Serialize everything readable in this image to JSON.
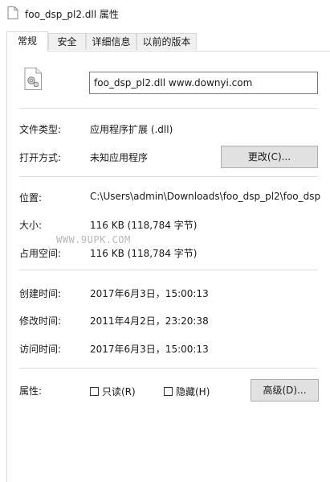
{
  "window": {
    "title": "foo_dsp_pl2.dll 属性",
    "icon": "document-icon"
  },
  "tabs": [
    "常规",
    "安全",
    "详细信息",
    "以前的版本"
  ],
  "file": {
    "name": "foo_dsp_pl2.dll www.downyi.com",
    "icon": "dll-gear-file-icon"
  },
  "type_row": {
    "label": "文件类型:",
    "value": "应用程序扩展 (.dll)"
  },
  "open_row": {
    "label": "打开方式:",
    "value": "未知应用程序",
    "button": "更改(C)..."
  },
  "location_row": {
    "label": "位置:",
    "value": "C:\\Users\\admin\\Downloads\\foo_dsp_pl2\\foo_dsp"
  },
  "size_row": {
    "label": "大小:",
    "value": "116 KB (118,784 字节)"
  },
  "watermark": "WWW.9UPK.COM",
  "disk_size_row": {
    "label": "占用空间:",
    "value": "116 KB (118,784 字节)"
  },
  "created_row": {
    "label": "创建时间:",
    "value": "2017年6月3日，15:00:13"
  },
  "modified_row": {
    "label": "修改时间:",
    "value": "2011年4月2日，23:20:38"
  },
  "accessed_row": {
    "label": "访问时间:",
    "value": "2017年6月3日，15:00:13"
  },
  "attributes": {
    "label": "属性:",
    "readonly_label": "只读(R)",
    "readonly_checked": false,
    "hidden_label": "隐藏(H)",
    "hidden_checked": false,
    "advanced_button": "高级(D)..."
  }
}
